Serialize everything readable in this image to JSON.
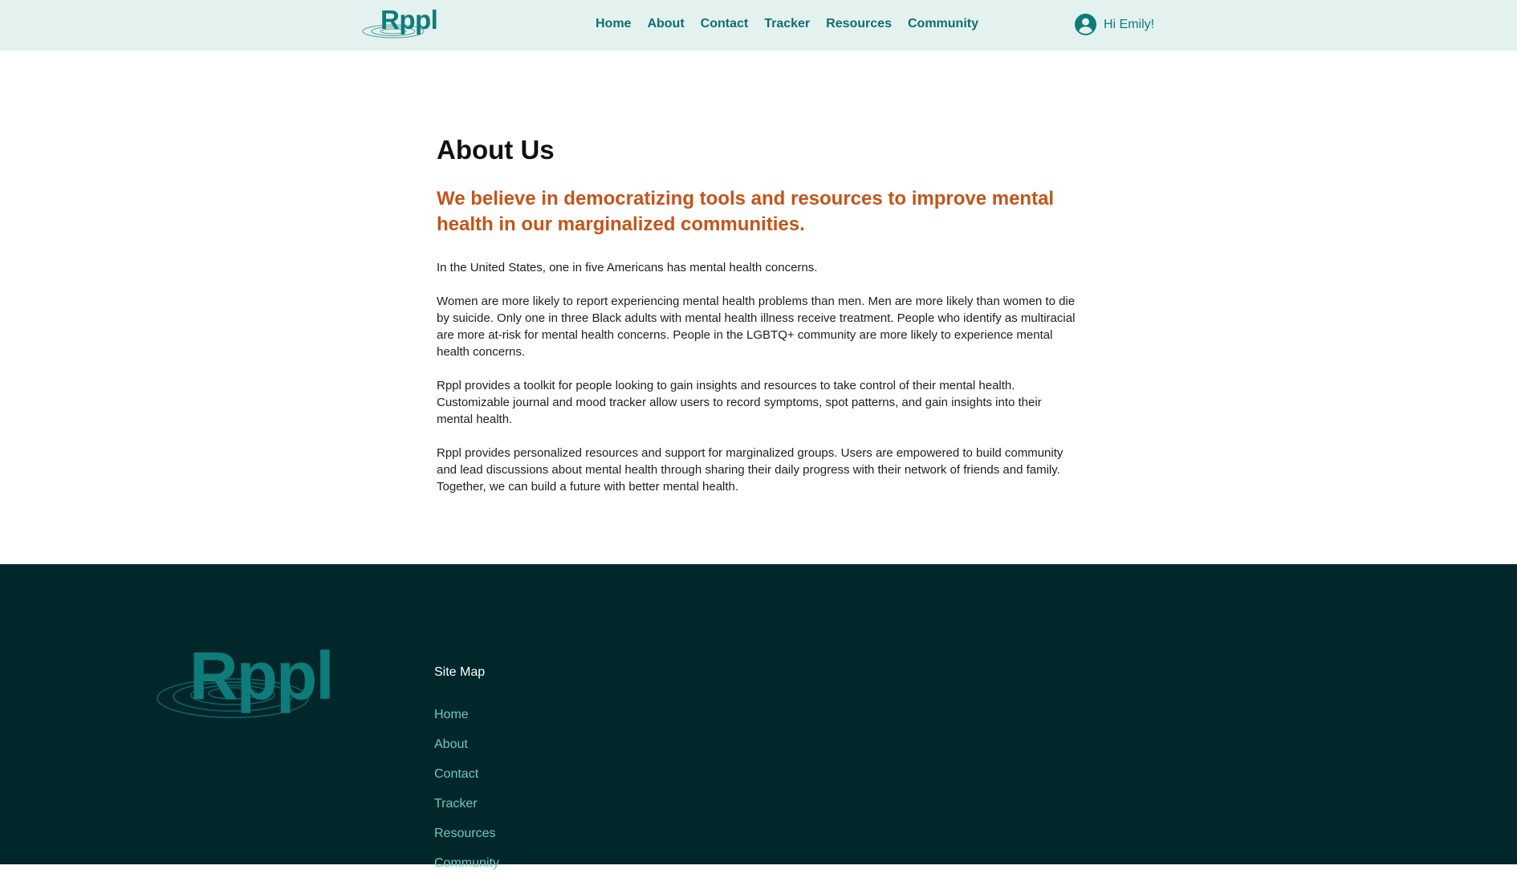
{
  "brand": {
    "name": "Rppl"
  },
  "nav": {
    "items": [
      {
        "label": "Home"
      },
      {
        "label": "About"
      },
      {
        "label": "Contact"
      },
      {
        "label": "Tracker"
      },
      {
        "label": "Resources"
      },
      {
        "label": "Community"
      }
    ]
  },
  "user": {
    "greeting": "Hi Emily!",
    "icon": "user-circle-icon"
  },
  "main": {
    "title": "About Us",
    "tagline": "We believe in democratizing tools and resources to improve mental health in our marginalized communities.",
    "paragraphs": [
      "In the United States, one in five Americans has mental health concerns.",
      "Women are more likely to report experiencing mental health problems than men. Men are more likely than women to die by suicide. Only one in three Black adults with mental health illness receive treatment. People who identify as multiracial are more at-risk for mental health concerns. People in the LGBTQ+ community are more likely to experience mental health concerns.",
      "Rppl provides a toolkit for people looking to gain insights and resources to take control of their mental health. Customizable journal and mood tracker allow users to record symptoms, spot patterns, and gain insights into their mental health.",
      "Rppl provides personalized resources and support for marginalized groups. Users are empowered to build community and lead discussions about mental health through sharing their daily progress with their network of friends and family. Together, we can build a future with better mental health."
    ]
  },
  "footer": {
    "sitemap_title": "Site Map",
    "links": [
      {
        "label": "Home"
      },
      {
        "label": "About"
      },
      {
        "label": "Contact"
      },
      {
        "label": "Tracker"
      },
      {
        "label": "Resources"
      },
      {
        "label": "Community"
      }
    ]
  },
  "colors": {
    "header_bg": "#e4f2ef",
    "brand_teal": "#0e7c7b",
    "tagline_orange": "#c4541a",
    "footer_bg": "#02272b",
    "footer_link": "#6fc6c0"
  }
}
